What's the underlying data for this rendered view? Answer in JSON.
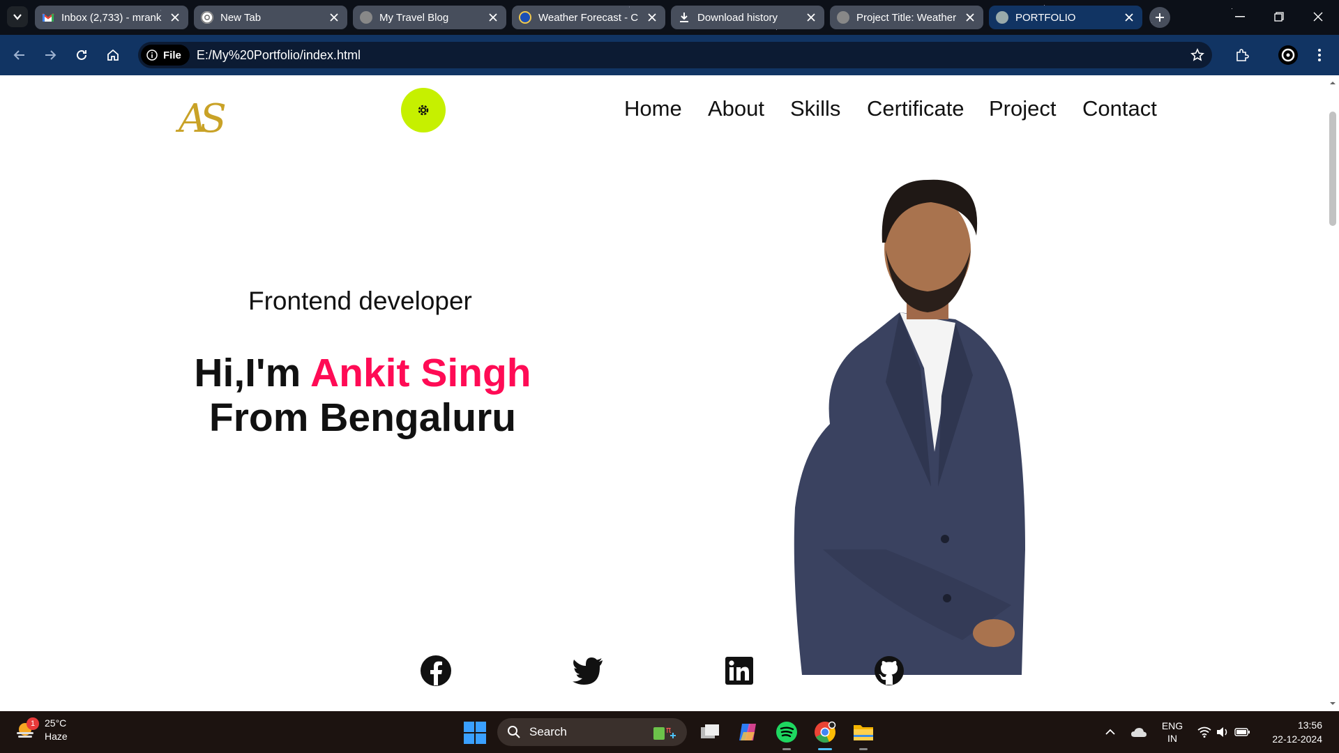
{
  "browser": {
    "tabs": [
      {
        "title": "Inbox (2,733) - mrank",
        "icon": "gmail-icon",
        "active": false
      },
      {
        "title": "New Tab",
        "icon": "chrome-icon",
        "active": false
      },
      {
        "title": "My Travel Blog",
        "icon": "globe-icon",
        "active": false
      },
      {
        "title": "Weather Forecast - C",
        "icon": "weather-app-icon",
        "active": false
      },
      {
        "title": "Download history",
        "icon": "download-icon",
        "active": false
      },
      {
        "title": "Project Title: Weather",
        "icon": "globe-icon",
        "active": false
      },
      {
        "title": "PORTFOLIO",
        "icon": "globe-icon",
        "active": true
      }
    ],
    "address": {
      "chip": "File",
      "url": "E:/My%20Portfolio/index.html"
    }
  },
  "site": {
    "logo": "AS",
    "nav": [
      "Home",
      "About",
      "Skills",
      "Certificate",
      "Project",
      "Contact"
    ],
    "hero": {
      "subtitle": "Frontend developer",
      "greeting": "Hi,I'm ",
      "name": "Ankit Singh",
      "location_line": "From Bengaluru"
    },
    "social": [
      "facebook-icon",
      "twitter-icon",
      "linkedin-icon",
      "github-icon"
    ],
    "colors": {
      "accent": "#ff0b55",
      "theme_button": "#c6f000",
      "logo": "#c9a227"
    }
  },
  "taskbar": {
    "weather": {
      "temp": "25°C",
      "condition": "Haze",
      "badge": "1"
    },
    "search_label": "Search",
    "language": {
      "top": "ENG",
      "bottom": "IN"
    },
    "time": "13:56",
    "date": "22-12-2024"
  }
}
